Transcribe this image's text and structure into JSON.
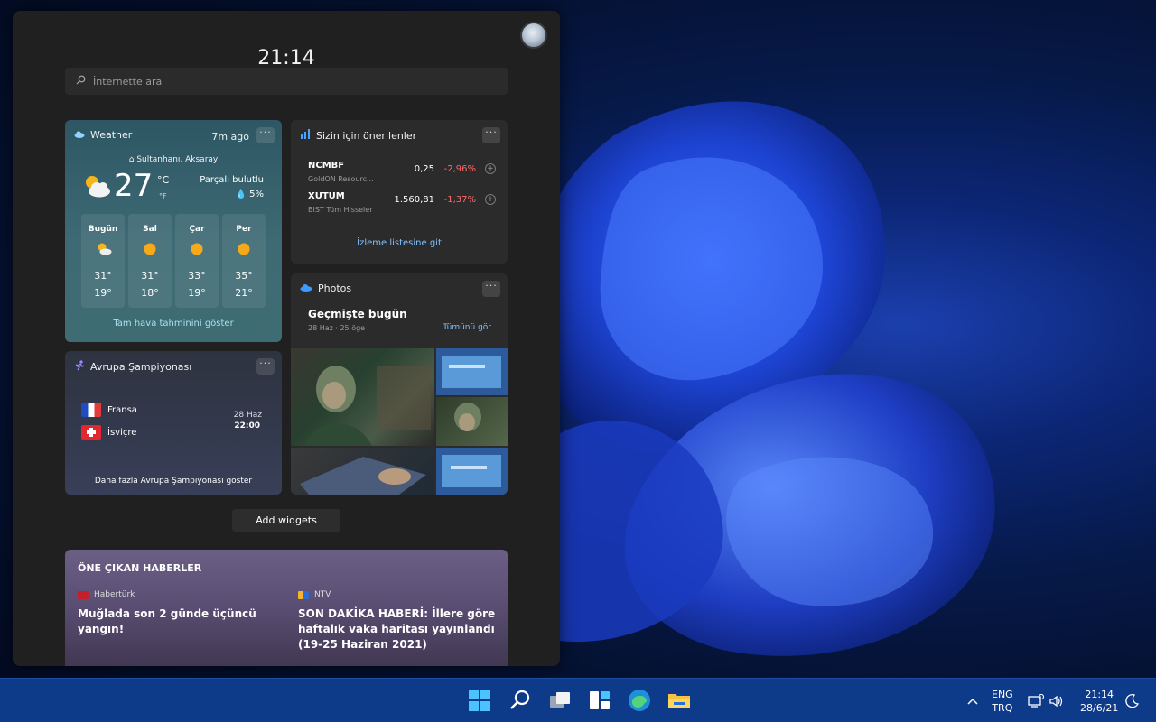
{
  "panel": {
    "clock": "21:14",
    "search_placeholder": "İnternette ara"
  },
  "weather": {
    "title": "Weather",
    "updated": "7m ago",
    "location": "Sultanhanı, Aksaray",
    "temp": "27",
    "unit_c": "°C",
    "unit_f": "°F",
    "condition": "Parçalı bulutlu",
    "rain": "5%",
    "days": [
      {
        "name": "Bugün",
        "icon": "partly-cloudy-icon",
        "hi": "31°",
        "lo": "19°"
      },
      {
        "name": "Sal",
        "icon": "sun-icon",
        "hi": "31°",
        "lo": "18°"
      },
      {
        "name": "Çar",
        "icon": "sun-icon",
        "hi": "33°",
        "lo": "19°"
      },
      {
        "name": "Per",
        "icon": "sun-icon",
        "hi": "35°",
        "lo": "21°"
      }
    ],
    "link": "Tam hava tahminini göster"
  },
  "stocks": {
    "title": "Sizin için önerilenler",
    "items": [
      {
        "symbol": "NCMBF",
        "name": "GoldON Resourc...",
        "price": "0,25",
        "change": "-2,96%"
      },
      {
        "symbol": "XUTUM",
        "name": "BIST Tüm Hisseler",
        "price": "1.560,81",
        "change": "-1,37%"
      }
    ],
    "link": "İzleme listesine git"
  },
  "photos": {
    "title": "Photos",
    "heading": "Geçmişte bugün",
    "sub": "28 Haz · 25 öge",
    "see_all": "Tümünü gör"
  },
  "euro": {
    "title": "Avrupa Şampiyonası",
    "team1": "Fransa",
    "team2": "İsviçre",
    "date": "28 Haz",
    "time": "22:00",
    "link": "Daha fazla Avrupa Şampiyonası göster"
  },
  "add_widgets": "Add widgets",
  "news": {
    "heading": "ÖNE ÇIKAN HABERLER",
    "items": [
      {
        "source": "Habertürk",
        "headline": "Muğlada son 2 günde üçüncü yangın!"
      },
      {
        "source": "NTV",
        "headline": "SON DAKİKA HABERİ: İllere göre haftalık vaka haritası yayınlandı (19-25 Haziran 2021)"
      }
    ]
  },
  "taskbar": {
    "lang_top": "ENG",
    "lang_bottom": "TRQ",
    "time": "21:14",
    "date": "28/6/21"
  },
  "colors": {
    "accent": "#7fc1ff",
    "negative": "#ff6b6b",
    "taskbar": "#0e3a8a"
  }
}
